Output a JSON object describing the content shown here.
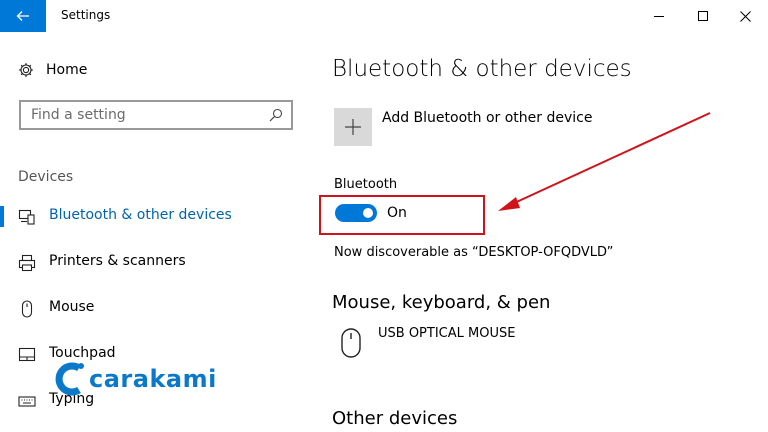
{
  "window": {
    "title": "Settings",
    "controls": [
      "minimize-icon",
      "maximize-icon",
      "close-icon"
    ]
  },
  "sidebar": {
    "home_label": "Home",
    "search_placeholder": "Find a setting",
    "section": "Devices",
    "items": [
      {
        "label": "Bluetooth & other devices",
        "icon": "bluetooth-devices-icon",
        "active": true
      },
      {
        "label": "Printers & scanners",
        "icon": "printer-icon",
        "active": false
      },
      {
        "label": "Mouse",
        "icon": "mouse-icon",
        "active": false
      },
      {
        "label": "Touchpad",
        "icon": "touchpad-icon",
        "active": false
      },
      {
        "label": "Typing",
        "icon": "keyboard-icon",
        "active": false
      }
    ]
  },
  "content": {
    "title": "Bluetooth & other devices",
    "add_device_label": "Add Bluetooth or other device",
    "bluetooth_heading": "Bluetooth",
    "bluetooth_state": "On",
    "bluetooth_on": true,
    "discoverable_text": "Now discoverable as “DESKTOP-OFQDVLD”",
    "mouse_section": "Mouse, keyboard, & pen",
    "mouse_device": "USB OPTICAL MOUSE",
    "other_section": "Other devices"
  },
  "watermark": {
    "text": "carakami"
  },
  "colors": {
    "accent": "#0078d7",
    "annotation_red": "#d0121a",
    "watermark_blue": "#0b79c9"
  }
}
